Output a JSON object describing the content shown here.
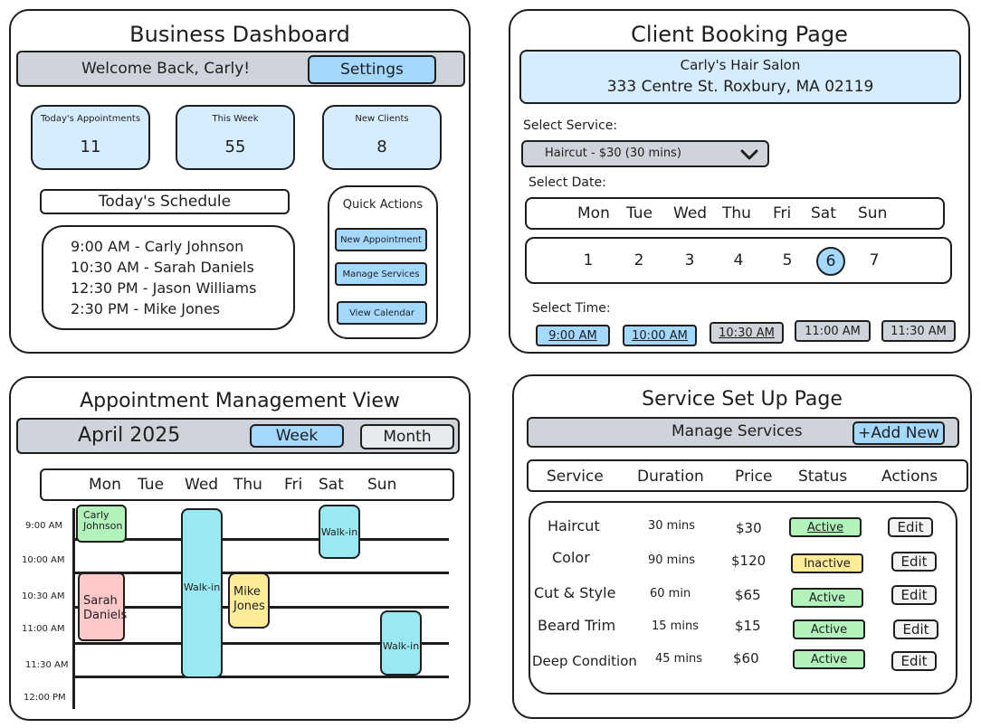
{
  "dashboard": {
    "title": "Business Dashboard",
    "welcome": "Welcome Back, Carly!",
    "settings_label": "Settings",
    "stats": [
      {
        "label": "Today's Appointments",
        "value": "11"
      },
      {
        "label": "This Week",
        "value": "55"
      },
      {
        "label": "New Clients",
        "value": "8"
      }
    ],
    "schedule_title": "Today's Schedule",
    "schedule": [
      "9:00 AM - Carly Johnson",
      "10:30 AM - Sarah Daniels",
      "12:30 PM - Jason Williams",
      "2:30 PM - Mike Jones"
    ],
    "quick_actions_title": "Quick Actions",
    "quick_actions": [
      "New Appointment",
      "Manage Services",
      "View Calendar"
    ]
  },
  "booking": {
    "title": "Client Booking Page",
    "salon_name": "Carly's Hair Salon",
    "salon_address": "333 Centre St. Roxbury, MA 02119",
    "select_service_label": "Select Service:",
    "service_value": "Haircut - $30 (30 mins)",
    "select_date_label": "Select Date:",
    "days": [
      "Mon",
      "Tue",
      "Wed",
      "Thu",
      "Fri",
      "Sat",
      "Sun"
    ],
    "dates": [
      "1",
      "2",
      "3",
      "4",
      "5",
      "6",
      "7"
    ],
    "selected_date": "6",
    "select_time_label": "Select Time:",
    "times": [
      {
        "label": "9:00 AM",
        "state": "available"
      },
      {
        "label": "10:00 AM",
        "state": "available"
      },
      {
        "label": "10:30 AM",
        "state": "unavailable"
      },
      {
        "label": "11:00 AM",
        "state": "unavailable"
      },
      {
        "label": "11:30 AM",
        "state": "unavailable"
      }
    ]
  },
  "appointments": {
    "title": "Appointment Management View",
    "month": "April 2025",
    "week_label": "Week",
    "month_label": "Month",
    "days": [
      "Mon",
      "Tue",
      "Wed",
      "Thu",
      "Fri",
      "Sat",
      "Sun"
    ],
    "times": [
      "9:00 AM",
      "10:00 AM",
      "10:30 AM",
      "11:00 AM",
      "11:30 AM",
      "12:00 PM"
    ],
    "events": [
      {
        "name": "Carly Johnson",
        "color": "#b2f2bb"
      },
      {
        "name": "Sarah Daniels",
        "color": "#ffc9c9"
      },
      {
        "name": "Walk-in",
        "color": "#99e9f2"
      },
      {
        "name": "Mike Jones",
        "color": "#ffec99"
      },
      {
        "name": "Walk-in",
        "color": "#99e9f2"
      },
      {
        "name": "Walk-in",
        "color": "#99e9f2"
      }
    ]
  },
  "services": {
    "title": "Service Set Up Page",
    "manage_label": "Manage Services",
    "add_new_label": "+Add New",
    "headers": [
      "Service",
      "Duration",
      "Price",
      "Status",
      "Actions"
    ],
    "rows": [
      {
        "service": "Haircut",
        "duration": "30 mins",
        "price": "$30",
        "status": "Active",
        "action": "Edit"
      },
      {
        "service": "Color",
        "duration": "90 mins",
        "price": "$120",
        "status": "Inactive",
        "action": "Edit"
      },
      {
        "service": "Cut & Style",
        "duration": "60 min",
        "price": "$65",
        "status": "Active",
        "action": "Edit"
      },
      {
        "service": "Beard Trim",
        "duration": "15 mins",
        "price": "$15",
        "status": "Active",
        "action": "Edit"
      },
      {
        "service": "Deep Condition",
        "duration": "45 mins",
        "price": "$60",
        "status": "Active",
        "action": "Edit"
      }
    ]
  },
  "colors": {
    "light_blue": "#d6ecff",
    "button_blue": "#a5d8ff",
    "gray": "#ced4da",
    "active_green": "#b2f2bb",
    "inactive_yellow": "#ffec99",
    "walkin_cyan": "#99e9f2",
    "outline": "#1e1e1e"
  }
}
